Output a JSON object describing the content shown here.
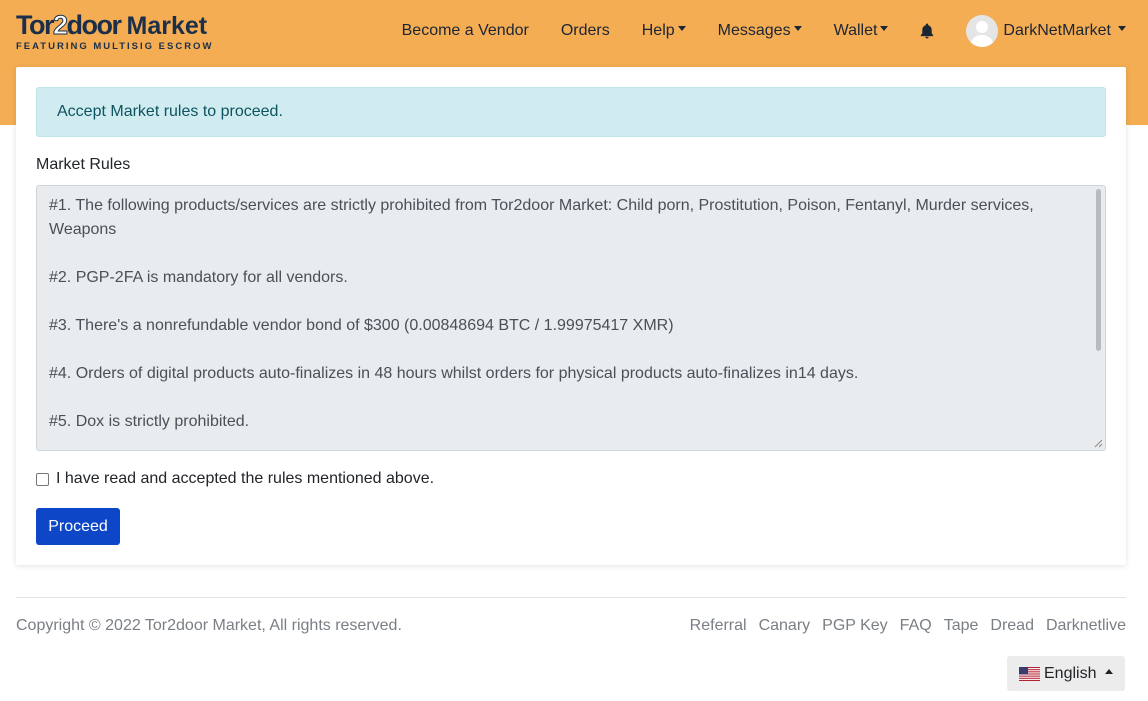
{
  "brand": {
    "logo_main_a": "Tor",
    "logo_main_b": "2",
    "logo_main_c": "door",
    "logo_market": "Market",
    "logo_tagline": "FEATURING MULTISIG ESCROW"
  },
  "nav": {
    "items": [
      {
        "label": "Become a Vendor",
        "dropdown": false
      },
      {
        "label": "Orders",
        "dropdown": false
      },
      {
        "label": "Help",
        "dropdown": true
      },
      {
        "label": "Messages",
        "dropdown": true
      },
      {
        "label": "Wallet",
        "dropdown": true
      }
    ],
    "notification_icon": "bell-icon",
    "user": {
      "name": "DarkNetMarket",
      "avatar_icon": "user-avatar-icon"
    }
  },
  "alert": {
    "text": "Accept Market rules to proceed."
  },
  "rules": {
    "label": "Market Rules",
    "items": [
      "#1.  The following products/services are strictly prohibited from Tor2door Market: Child porn, Prostitution, Poison, Fentanyl, Murder services, Weapons",
      "#2. PGP-2FA is mandatory for all vendors.",
      "#3. There's a nonrefundable vendor bond of $300 (0.00848694 BTC / 1.99975417 XMR)",
      "#4. Orders of digital products auto-finalizes in 48 hours whilst orders for physical products auto-finalizes in14 days.",
      "#5. Dox is strictly prohibited."
    ]
  },
  "accept": {
    "label": "I have read and accepted the rules mentioned above.",
    "checked": false
  },
  "proceed_button": {
    "label": "Proceed"
  },
  "footer": {
    "copyright": "Copyright © 2022 Tor2door Market, All rights reserved.",
    "links": [
      "Referral",
      "Canary",
      "PGP Key",
      "FAQ",
      "Tape",
      "Dread",
      "Darknetlive"
    ],
    "language": {
      "label": "English",
      "flag_icon": "us-flag-icon"
    }
  },
  "colors": {
    "header_bg": "#f4ad53",
    "alert_bg": "#d1ecf1",
    "alert_text": "#0c5460",
    "primary_button": "#0d47c7"
  }
}
